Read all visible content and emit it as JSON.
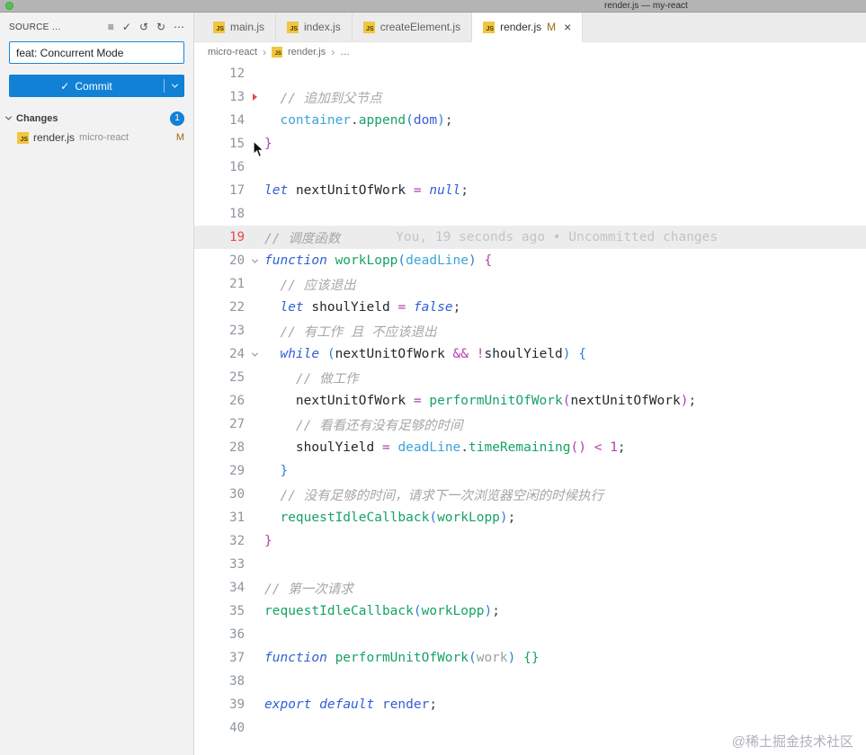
{
  "window": {
    "title": "render.js — my-react"
  },
  "icons": {
    "js_label": "JS"
  },
  "sidebar": {
    "header": {
      "title": "SOURCE …",
      "icons": [
        {
          "name": "list",
          "glyph": "≡"
        },
        {
          "name": "check",
          "glyph": "✓"
        },
        {
          "name": "undo",
          "glyph": "↺"
        },
        {
          "name": "refresh",
          "glyph": "↻"
        },
        {
          "name": "more",
          "glyph": "⋯"
        }
      ]
    },
    "commit_input": {
      "value": "feat: Concurrent Mode"
    },
    "commit_button": {
      "check": "✓",
      "label": "Commit"
    },
    "changes": {
      "label": "Changes",
      "badge": "1"
    },
    "files": [
      {
        "name": "render.js",
        "path": "micro-react",
        "status": "M"
      }
    ]
  },
  "tabs": [
    {
      "label": "main.js",
      "active": false
    },
    {
      "label": "index.js",
      "active": false
    },
    {
      "label": "createElement.js",
      "active": false
    },
    {
      "label": "render.js",
      "active": true,
      "status": "M",
      "close": "×"
    }
  ],
  "breadcrumb": {
    "items": [
      "micro-react",
      "render.js",
      "…"
    ],
    "separator": "›"
  },
  "editor": {
    "blame": "You, 19 seconds ago • Uncommitted changes",
    "lines": [
      {
        "n": 12,
        "t": []
      },
      {
        "n": 13,
        "marker": true,
        "t": [
          [
            "  ",
            "ws"
          ],
          [
            "// 追加到父节点",
            "cm"
          ]
        ]
      },
      {
        "n": 14,
        "t": [
          [
            "  ",
            "ws"
          ],
          [
            "container",
            "vb"
          ],
          [
            ".",
            "pu"
          ],
          [
            "append",
            "fn"
          ],
          [
            "(",
            "b2"
          ],
          [
            "dom",
            "pd"
          ],
          [
            ")",
            "b2"
          ],
          [
            ";",
            "pu"
          ]
        ]
      },
      {
        "n": 15,
        "t": [
          [
            "}",
            "b1"
          ]
        ]
      },
      {
        "n": 16,
        "t": []
      },
      {
        "n": 17,
        "t": [
          [
            "let",
            "kw"
          ],
          [
            " ",
            "ws"
          ],
          [
            "nextUnitOfWork",
            "vd"
          ],
          [
            " ",
            "ws"
          ],
          [
            "=",
            "op"
          ],
          [
            " ",
            "ws"
          ],
          [
            "null",
            "kw"
          ],
          [
            ";",
            "pu"
          ]
        ]
      },
      {
        "n": 18,
        "t": []
      },
      {
        "n": 19,
        "hl": true,
        "red": true,
        "blame": "You, 19 seconds ago • Uncommitted changes",
        "t": [
          [
            "// 调度函数",
            "cm"
          ]
        ]
      },
      {
        "n": 20,
        "fold": true,
        "t": [
          [
            "function",
            "kw"
          ],
          [
            " ",
            "ws"
          ],
          [
            "workLopp",
            "fn"
          ],
          [
            "(",
            "b2"
          ],
          [
            "deadLine",
            "vb"
          ],
          [
            ")",
            "b2"
          ],
          [
            " ",
            "ws"
          ],
          [
            "{",
            "b1"
          ]
        ]
      },
      {
        "n": 21,
        "t": [
          [
            "  ",
            "ws"
          ],
          [
            "// 应该退出",
            "cm"
          ]
        ]
      },
      {
        "n": 22,
        "t": [
          [
            "  ",
            "ws"
          ],
          [
            "let",
            "kw"
          ],
          [
            " ",
            "ws"
          ],
          [
            "shoulYield",
            "vd"
          ],
          [
            " ",
            "ws"
          ],
          [
            "=",
            "op"
          ],
          [
            " ",
            "ws"
          ],
          [
            "false",
            "kw"
          ],
          [
            ";",
            "pu"
          ]
        ]
      },
      {
        "n": 23,
        "t": [
          [
            "  ",
            "ws"
          ],
          [
            "// 有工作 且 不应该退出",
            "cm"
          ]
        ]
      },
      {
        "n": 24,
        "fold": true,
        "t": [
          [
            "  ",
            "ws"
          ],
          [
            "while",
            "kw"
          ],
          [
            " ",
            "ws"
          ],
          [
            "(",
            "b2"
          ],
          [
            "nextUnitOfWork",
            "vd"
          ],
          [
            " ",
            "ws"
          ],
          [
            "&&",
            "op"
          ],
          [
            " ",
            "ws"
          ],
          [
            "!",
            "op"
          ],
          [
            "shoulYield",
            "vd"
          ],
          [
            ")",
            "b2"
          ],
          [
            " ",
            "ws"
          ],
          [
            "{",
            "b2"
          ]
        ]
      },
      {
        "n": 25,
        "t": [
          [
            "    ",
            "ws"
          ],
          [
            "// 做工作",
            "cm"
          ]
        ]
      },
      {
        "n": 26,
        "t": [
          [
            "    ",
            "ws"
          ],
          [
            "nextUnitOfWork",
            "vd"
          ],
          [
            " ",
            "ws"
          ],
          [
            "=",
            "op"
          ],
          [
            " ",
            "ws"
          ],
          [
            "performUnitOfWork",
            "fn"
          ],
          [
            "(",
            "b1"
          ],
          [
            "nextUnitOfWork",
            "vd"
          ],
          [
            ")",
            "b1"
          ],
          [
            ";",
            "pu"
          ]
        ]
      },
      {
        "n": 27,
        "t": [
          [
            "    ",
            "ws"
          ],
          [
            "// 看看还有没有足够的时间",
            "cm"
          ]
        ]
      },
      {
        "n": 28,
        "t": [
          [
            "    ",
            "ws"
          ],
          [
            "shoulYield",
            "vd"
          ],
          [
            " ",
            "ws"
          ],
          [
            "=",
            "op"
          ],
          [
            " ",
            "ws"
          ],
          [
            "deadLine",
            "vb"
          ],
          [
            ".",
            "pu"
          ],
          [
            "timeRemaining",
            "fn"
          ],
          [
            "(",
            "b1"
          ],
          [
            ")",
            "b1"
          ],
          [
            " ",
            "ws"
          ],
          [
            "<",
            "op"
          ],
          [
            " ",
            "ws"
          ],
          [
            "1",
            "num"
          ],
          [
            ";",
            "pu"
          ]
        ]
      },
      {
        "n": 29,
        "t": [
          [
            "  ",
            "ws"
          ],
          [
            "}",
            "b2"
          ]
        ]
      },
      {
        "n": 30,
        "t": [
          [
            "  ",
            "ws"
          ],
          [
            "// 没有足够的时间，请求下一次浏览器空闲的时候执行",
            "cm"
          ]
        ]
      },
      {
        "n": 31,
        "t": [
          [
            "  ",
            "ws"
          ],
          [
            "requestIdleCallback",
            "fn"
          ],
          [
            "(",
            "b2"
          ],
          [
            "workLopp",
            "fn"
          ],
          [
            ")",
            "b2"
          ],
          [
            ";",
            "pu"
          ]
        ]
      },
      {
        "n": 32,
        "t": [
          [
            "}",
            "b1"
          ]
        ]
      },
      {
        "n": 33,
        "t": []
      },
      {
        "n": 34,
        "t": [
          [
            "// 第一次请求",
            "cm"
          ]
        ]
      },
      {
        "n": 35,
        "t": [
          [
            "requestIdleCallback",
            "fn"
          ],
          [
            "(",
            "b2"
          ],
          [
            "workLopp",
            "fn"
          ],
          [
            ")",
            "b2"
          ],
          [
            ";",
            "pu"
          ]
        ]
      },
      {
        "n": 36,
        "t": []
      },
      {
        "n": 37,
        "t": [
          [
            "function",
            "kw"
          ],
          [
            " ",
            "ws"
          ],
          [
            "performUnitOfWork",
            "fn"
          ],
          [
            "(",
            "b2"
          ],
          [
            "work",
            "pg"
          ],
          [
            ")",
            "b2"
          ],
          [
            " ",
            "ws"
          ],
          [
            "{}",
            "b3"
          ]
        ]
      },
      {
        "n": 38,
        "t": []
      },
      {
        "n": 39,
        "t": [
          [
            "export",
            "kw"
          ],
          [
            " ",
            "ws"
          ],
          [
            "default",
            "kw"
          ],
          [
            " ",
            "ws"
          ],
          [
            "render",
            "id"
          ],
          [
            ";",
            "pu"
          ]
        ]
      },
      {
        "n": 40,
        "t": []
      }
    ]
  },
  "watermark": "@稀土掘金技术社区",
  "colors": {
    "accent_blue": "#1181d6",
    "modified_orange": "#9f6a0a",
    "line_red": "#e5494d",
    "js_icon_yellow": "#f0c541",
    "titlebar_gray": "#b4b4b4",
    "sidebar_gray": "#f2f2f2"
  }
}
